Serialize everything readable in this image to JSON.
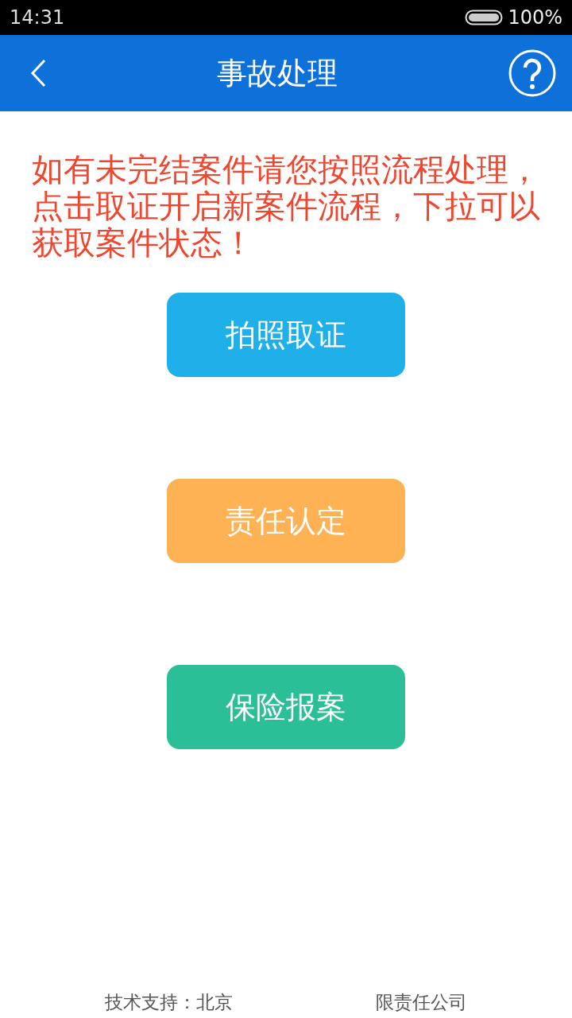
{
  "status_bar": {
    "time": "14:31",
    "battery": "100%"
  },
  "header": {
    "title": "事故处理"
  },
  "notice": "如有未完结案件请您按照流程处理，点击取证开启新案件流程，下拉可以获取案件状态！",
  "buttons": [
    {
      "label": "拍照取证",
      "color": "#1fb0ea"
    },
    {
      "label": "责任认定",
      "color": "#ffb253"
    },
    {
      "label": "保险报案",
      "color": "#2bbf97"
    }
  ],
  "footer": [
    "技术支持：北京",
    "限责任公司"
  ]
}
